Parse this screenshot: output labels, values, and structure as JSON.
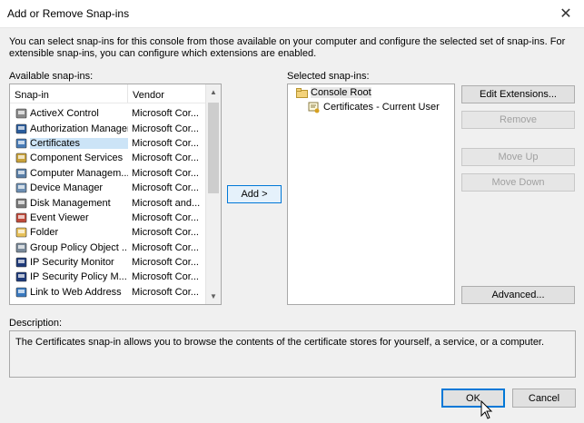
{
  "window": {
    "title": "Add or Remove Snap-ins",
    "close_label": "✕"
  },
  "intro_text": "You can select snap-ins for this console from those available on your computer and configure the selected set of snap-ins. For extensible snap-ins, you can configure which extensions are enabled.",
  "available": {
    "label": "Available snap-ins:",
    "columns": {
      "snapin": "Snap-in",
      "vendor": "Vendor"
    },
    "rows": [
      {
        "name": "ActiveX Control",
        "vendor": "Microsoft Cor...",
        "icon": "activex-icon",
        "color": "#8a8a8a"
      },
      {
        "name": "Authorization Manager",
        "vendor": "Microsoft Cor...",
        "icon": "authorization-icon",
        "color": "#2b5d9c"
      },
      {
        "name": "Certificates",
        "vendor": "Microsoft Cor...",
        "icon": "certificates-icon",
        "color": "#4a7db8"
      },
      {
        "name": "Component Services",
        "vendor": "Microsoft Cor...",
        "icon": "component-services-icon",
        "color": "#c9a23a"
      },
      {
        "name": "Computer Managem...",
        "vendor": "Microsoft Cor...",
        "icon": "computer-management-icon",
        "color": "#5a7fa8"
      },
      {
        "name": "Device Manager",
        "vendor": "Microsoft Cor...",
        "icon": "device-manager-icon",
        "color": "#6d8fb3"
      },
      {
        "name": "Disk Management",
        "vendor": "Microsoft and...",
        "icon": "disk-management-icon",
        "color": "#7a7a7a"
      },
      {
        "name": "Event Viewer",
        "vendor": "Microsoft Cor...",
        "icon": "event-viewer-icon",
        "color": "#c04a3a"
      },
      {
        "name": "Folder",
        "vendor": "Microsoft Cor...",
        "icon": "folder-icon",
        "color": "#e8c15a"
      },
      {
        "name": "Group Policy Object ...",
        "vendor": "Microsoft Cor...",
        "icon": "group-policy-icon",
        "color": "#7a8a9a"
      },
      {
        "name": "IP Security Monitor",
        "vendor": "Microsoft Cor...",
        "icon": "ip-security-monitor-icon",
        "color": "#1e3a7a"
      },
      {
        "name": "IP Security Policy M...",
        "vendor": "Microsoft Cor...",
        "icon": "ip-security-policy-icon",
        "color": "#1e3a7a"
      },
      {
        "name": "Link to Web Address",
        "vendor": "Microsoft Cor...",
        "icon": "link-icon",
        "color": "#3a7ac0"
      }
    ],
    "selected_index": 2
  },
  "add_button": "Add >",
  "selected": {
    "label": "Selected snap-ins:",
    "root": "Console Root",
    "child": "Certificates - Current User"
  },
  "side_buttons": {
    "edit_extensions": "Edit Extensions...",
    "remove": "Remove",
    "move_up": "Move Up",
    "move_down": "Move Down",
    "advanced": "Advanced..."
  },
  "description": {
    "label": "Description:",
    "text": "The Certificates snap-in allows you to browse the contents of the certificate stores for yourself, a service, or a computer."
  },
  "footer": {
    "ok": "OK",
    "cancel": "Cancel"
  }
}
